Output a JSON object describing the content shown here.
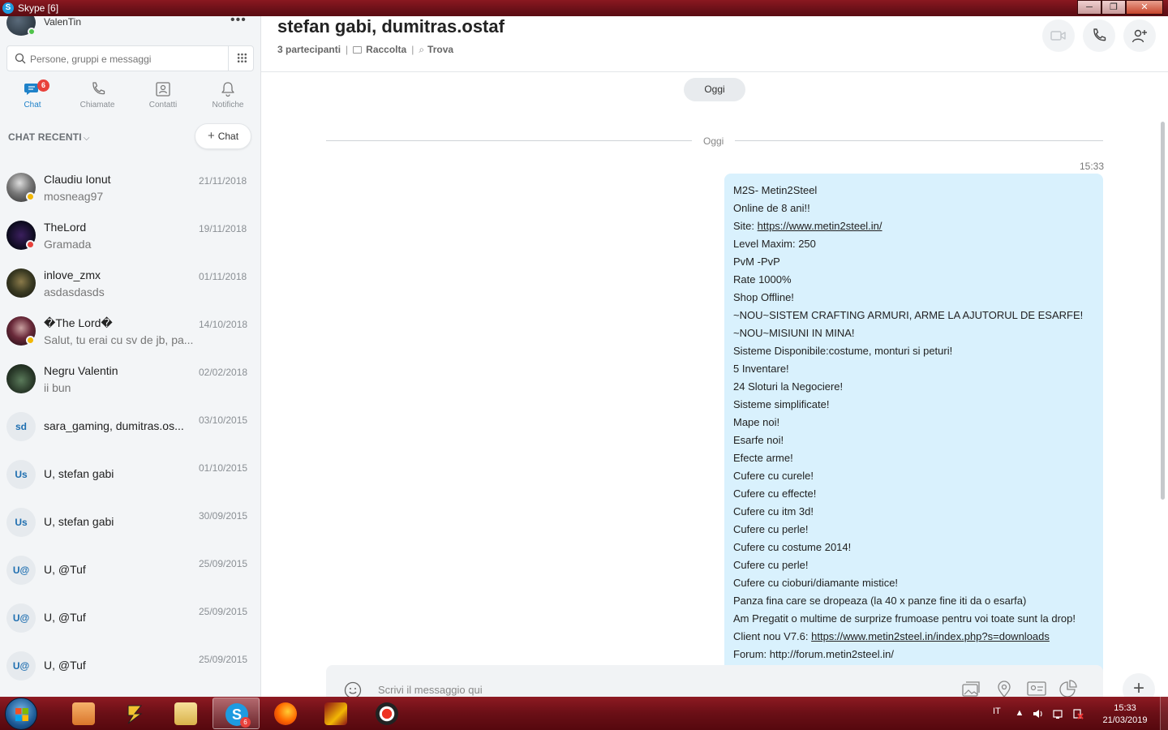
{
  "window": {
    "title": "Skype [6]",
    "app_icon": "S",
    "minimize": "─",
    "maximize": "❐",
    "close": "✕"
  },
  "profile": {
    "name": "ValenTin",
    "status_color": "#4fc34a",
    "more": "•••"
  },
  "search": {
    "placeholder": "Persone, gruppi e messaggi"
  },
  "nav": {
    "items": [
      {
        "label": "Chat",
        "icon": "chat-icon",
        "active": true,
        "badge": "6"
      },
      {
        "label": "Chiamate",
        "icon": "phone-icon"
      },
      {
        "label": "Contatti",
        "icon": "contacts-icon"
      },
      {
        "label": "Notifiche",
        "icon": "bell-icon"
      }
    ]
  },
  "recent": {
    "heading": "CHAT RECENTI",
    "chevron": "⌵",
    "new_chat_label": "Chat",
    "new_chat_icon": "+"
  },
  "chats": [
    {
      "name": "Claudiu Ionut",
      "last_message": "mosneag97",
      "date": "21/11/2018",
      "status": "away",
      "avatar": "photo"
    },
    {
      "name": "TheLord",
      "last_message": "Gramada",
      "date": "19/11/2018",
      "status": "busy",
      "avatar": "photo"
    },
    {
      "name": "inlove_zmx",
      "last_message": "asdasdasds",
      "date": "01/11/2018",
      "status": "",
      "avatar": "photo"
    },
    {
      "name": "�The Lord�",
      "last_message": "Salut, tu erai cu sv de jb, pa...",
      "date": "14/10/2018",
      "status": "away",
      "avatar": "photo"
    },
    {
      "name": "Negru Valentin",
      "last_message": "ii bun",
      "date": "02/02/2018",
      "status": "",
      "avatar": "photo"
    },
    {
      "name": "sara_gaming, dumitras.os...",
      "last_message": "",
      "date": "03/10/2015",
      "initials": "sd"
    },
    {
      "name": "U, stefan gabi",
      "last_message": "",
      "date": "01/10/2015",
      "initials": "Us"
    },
    {
      "name": "U, stefan gabi",
      "last_message": "",
      "date": "30/09/2015",
      "initials": "Us"
    },
    {
      "name": "U, @Tuf",
      "last_message": "",
      "date": "25/09/2015",
      "initials": "U@"
    },
    {
      "name": "U, @Tuf",
      "last_message": "",
      "date": "25/09/2015",
      "initials": "U@"
    },
    {
      "name": "U, @Tuf",
      "last_message": "",
      "date": "25/09/2015",
      "initials": "U@"
    }
  ],
  "conversation": {
    "title": "stefan gabi, dumitras.ostaf",
    "participants": "3 partecipanti",
    "gallery": "Raccolta",
    "find": "Trova",
    "day_pill": "Oggi",
    "day_separator": "Oggi",
    "message_time": "15:33",
    "message_lines": [
      "M2S- Metin2Steel",
      "Online de 8 ani!!",
      "Site: |https://www.metin2steel.in/",
      "Level Maxim: 250",
      "PvM -PvP",
      "Rate 1000%",
      "Shop Offline!",
      "~NOU~SISTEM CRAFTING ARMURI, ARME LA AJUTORUL DE ESARFE!",
      "~NOU~MISIUNI IN MINA!",
      "Sisteme Disponibile:costume, monturi si peturi!",
      "5 Inventare!",
      "24 Sloturi la Negociere!",
      "Sisteme simplificate!",
      "Mape noi!",
      "Esarfe noi!",
      "Efecte arme!",
      "Cufere cu curele!",
      "Cufere cu effecte!",
      "Cufere cu itm 3d!",
      "Cufere cu perle!",
      "Cufere cu costume 2014!",
      "Cufere cu perle!",
      "Cufere cu cioburi/diamante mistice!",
      "Panza fina care se dropeaza (la 40 x panze fine iti da o esarfa)",
      "Am Pregatit o multime de surprize frumoase pentru voi toate sunt la drop!",
      "Client nou V7.6: |https://www.metin2steel.in/index.php?s=downloads",
      "Forum: http://forum.metin2steel.in/"
    ],
    "composer_placeholder": "Scrivi il messaggio qui",
    "bubble_color": "#d9f1fd",
    "accent": "#1f82c9"
  },
  "taskbar": {
    "apps": [
      "media-player-icon",
      "winamp-icon",
      "file-explorer-icon",
      "skype-icon",
      "firefox-icon",
      "metin2-icon",
      "recorder-icon"
    ],
    "skype_badge": "6",
    "language": "IT",
    "tray_arrow": "▲",
    "time": "15:33",
    "date": "21/03/2019"
  }
}
